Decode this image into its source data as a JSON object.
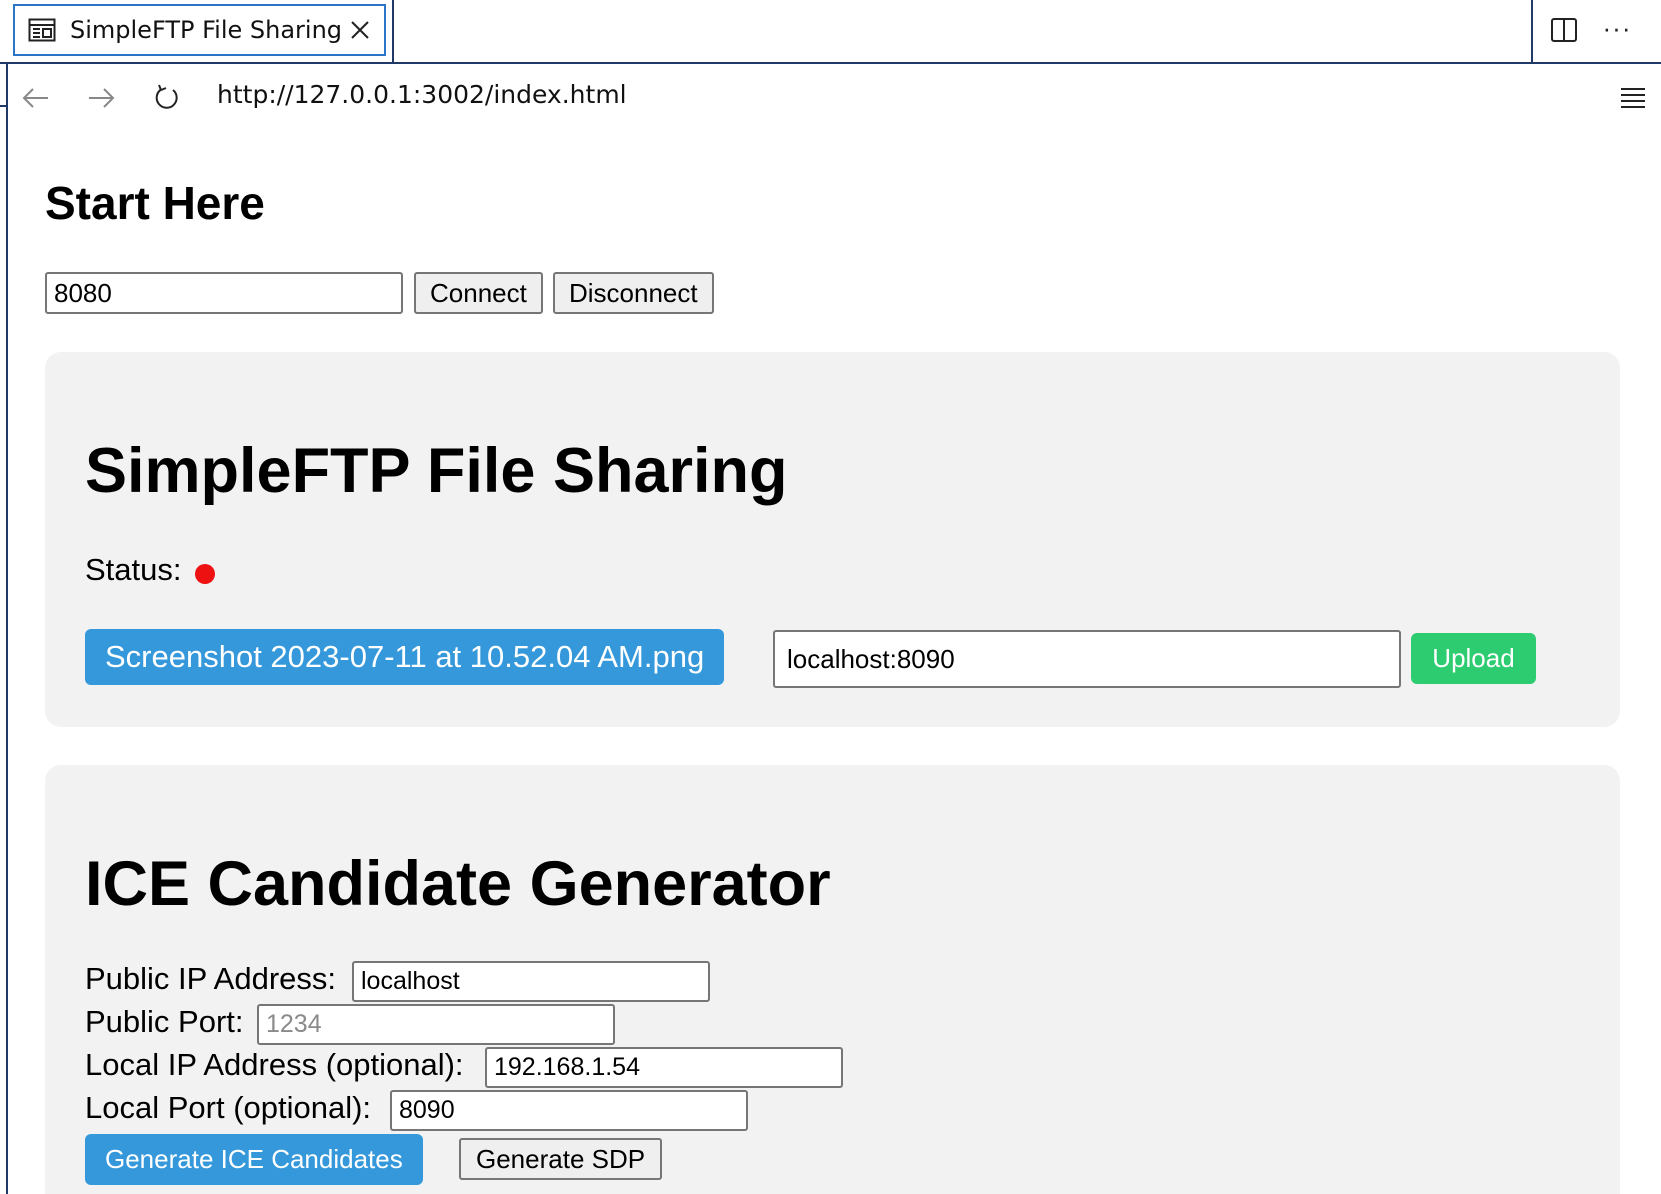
{
  "browser": {
    "tab": {
      "title": "SimpleFTP File Sharing",
      "icon": "page-icon",
      "close_icon": "close-icon"
    },
    "toolbar_icons": [
      "split-view-icon",
      "more-icon"
    ],
    "address_bar": {
      "url": "http://127.0.0.1:3002/index.html",
      "icons": [
        "back-icon",
        "forward-icon",
        "reload-icon",
        "menu-icon"
      ]
    },
    "more_glyph": "···"
  },
  "start": {
    "title": "Start Here",
    "port_value": "8080",
    "connect_label": "Connect",
    "disconnect_label": "Disconnect"
  },
  "sharing": {
    "title": "SimpleFTP File Sharing",
    "status_label": "Status:",
    "status_color": "#ee1111",
    "file_button_label": "Screenshot 2023-07-11 at 10.52.04 AM.png",
    "destination_value": "localhost:8090",
    "upload_label": "Upload",
    "colors": {
      "file_button": "#3498db",
      "upload_button": "#2ecc71"
    }
  },
  "ice": {
    "title": "ICE Candidate Generator",
    "public_ip_label": "Public IP Address:",
    "public_ip_value": "localhost",
    "public_port_label": "Public Port:",
    "public_port_placeholder": "1234",
    "local_ip_label": "Local IP Address (optional):",
    "local_ip_value": "192.168.1.54",
    "local_port_label": "Local Port (optional):",
    "local_port_value": "8090",
    "generate_ice_label": "Generate ICE Candidates",
    "generate_sdp_label": "Generate SDP"
  }
}
